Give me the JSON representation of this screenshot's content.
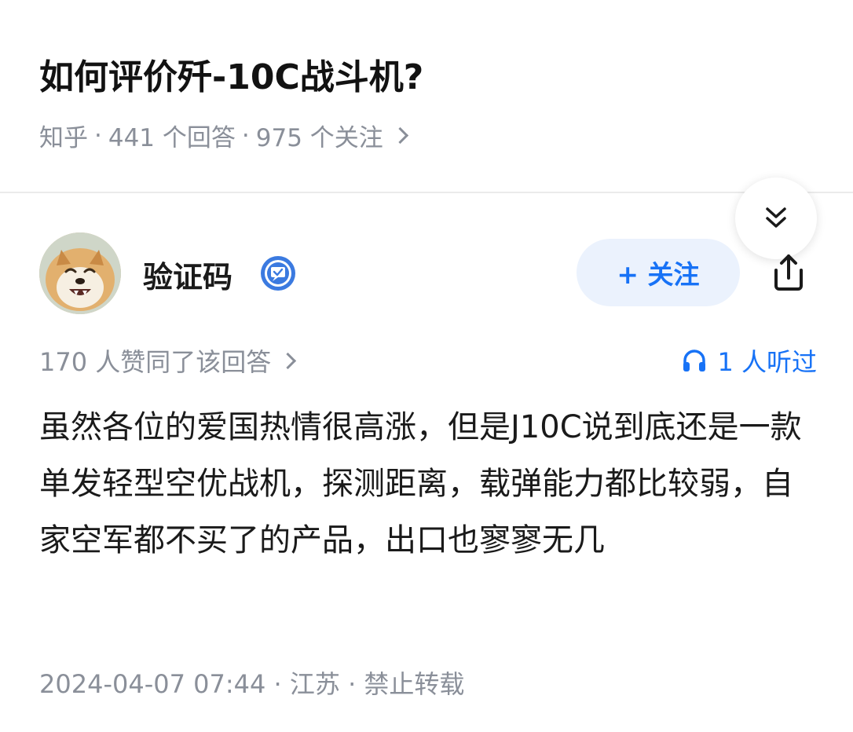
{
  "question": {
    "title": "如何评价歼-10C战斗机?",
    "source": "知乎",
    "answers_count": "441 个回答",
    "followers_count": "975 个关注"
  },
  "meta_separator": "·",
  "author": {
    "name": "验证码",
    "follow_label": "+ 关注"
  },
  "answer": {
    "votes_text": "170 人赞同了该回答",
    "listened_text": "1 人听过",
    "content": "虽然各位的爱国热情很高涨，但是J10C说到底还是一款单发轻型空优战机，探测距离，载弹能力都比较弱，自家空军都不买了的产品，出口也寥寥无几",
    "date": "2024-04-07 07:44",
    "location": "江苏",
    "copyright": "禁止转载"
  },
  "colors": {
    "accent": "#1772f6",
    "secondary_text": "#8a8f99",
    "follow_bg": "#ebf2fd",
    "badge": "#3b7ae0"
  },
  "icons": [
    "chevron-right-icon",
    "double-chevron-down-icon",
    "verified-badge-icon",
    "share-icon",
    "headphones-icon"
  ]
}
